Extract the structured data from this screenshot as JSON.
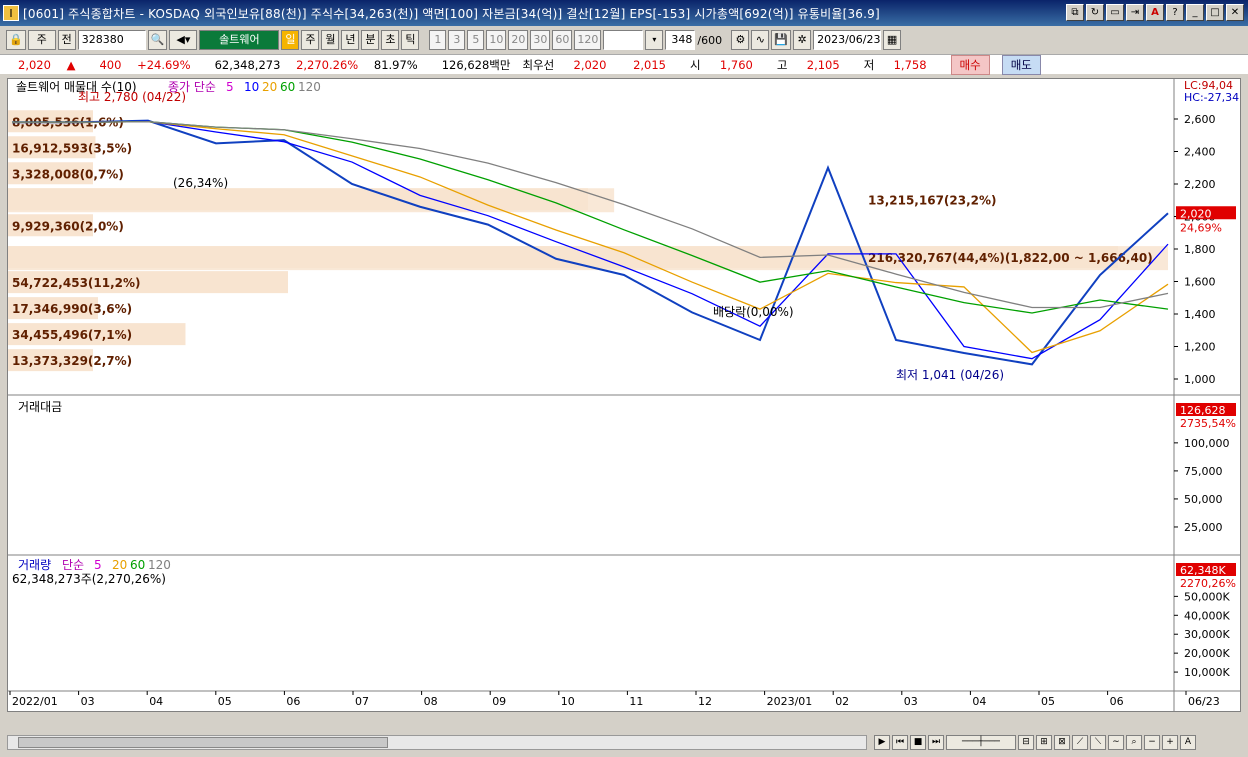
{
  "window": {
    "title": "[0601] 주식종합차트 - KOSDAQ 외국인보유[88(천)] 주식수[34,263(천)] 액면[100] 자본금[34(억)] 결산[12월] EPS[-153] 시가총액[692(억)] 유통비율[36.9]",
    "title_buttons": [
      "□",
      "⊡",
      "▭",
      "⇥",
      "A",
      "?",
      "_",
      "□",
      "X"
    ]
  },
  "toolbar": {
    "type_select": "주",
    "prev_label": "전",
    "code": "328380",
    "stock_name": "솔트웨어",
    "period_tabs": [
      "일",
      "주",
      "월",
      "년",
      "분",
      "초",
      "틱"
    ],
    "intervals": [
      "1",
      "3",
      "5",
      "10",
      "20",
      "30",
      "60",
      "120"
    ],
    "count": "348",
    "count_total": "/600",
    "date": "2023/06/23"
  },
  "quote": {
    "price": "2,020",
    "price_arrow": "▲",
    "change": "400",
    "change_pct": "+24.69%",
    "volume": "62,348,273",
    "volume_pct": "2,270.26%",
    "turnover_pct": "81.97%",
    "amount": "126,628백만",
    "best_bid_label": "최우선",
    "best_ask": "2,020",
    "best_bid": "2,015",
    "open_label": "시",
    "open": "1,760",
    "high_label": "고",
    "high": "2,105",
    "low_label": "저",
    "low": "1,758",
    "buy_label": "매수",
    "sell_label": "매도"
  },
  "chart_data": [
    {
      "type": "line",
      "panel": "price",
      "title": "솔트웨어 매물대 수(10)",
      "ma_legend": {
        "label": "종가 단순",
        "periods": [
          "5",
          "10",
          "20",
          "60",
          "120"
        ],
        "colors": [
          "#d000d0",
          "#0000ff",
          "#e8a000",
          "#00a000",
          "#808080"
        ]
      },
      "x": [
        "2022/01",
        "03",
        "04",
        "05",
        "06",
        "07",
        "08",
        "09",
        "10",
        "11",
        "12",
        "2023/01",
        "02",
        "03",
        "04",
        "05",
        "06",
        "06/23"
      ],
      "close_approx": [
        2580,
        2580,
        2590,
        2450,
        2470,
        2200,
        2060,
        1950,
        1740,
        1640,
        1410,
        1240,
        2300,
        1240,
        1160,
        1090,
        1640,
        2020
      ],
      "ylim": [
        950,
        2700
      ],
      "yticks": [
        "2,600",
        "2,400",
        "2,200",
        "2,000",
        "1,800",
        "1,600",
        "1,400",
        "1,200",
        "1,000"
      ],
      "right_labels": [
        "LC:94,04",
        "HC:-27,34"
      ],
      "last_price_tag": "2,020",
      "last_pct_tag": "24,69%",
      "volume_profile": [
        {
          "label": "8,005,536(1,6%)",
          "price": 2580,
          "share": 1.6
        },
        {
          "label": "16,912,593(3,5%)",
          "price": 2420,
          "share": 3.5
        },
        {
          "label": "3,328,008(0,7%)",
          "price": 2260,
          "share": 0.7
        },
        {
          "label": "13,215,167(23,2%)",
          "price": 2100,
          "share": 23.2
        },
        {
          "label": "9,929,360(2,0%)",
          "price": 1940,
          "share": 2.0
        },
        {
          "label": "216,320,767(44,4%)(1,822,00 ~ 1,666,40)",
          "price": 1744,
          "share": 44.4
        },
        {
          "label": "54,722,453(11,2%)",
          "price": 1590,
          "share": 11.2
        },
        {
          "label": "17,346,990(3,6%)",
          "price": 1430,
          "share": 3.6
        },
        {
          "label": "34,455,496(7,1%)",
          "price": 1270,
          "share": 7.1
        },
        {
          "label": "13,373,329(2,7%)",
          "price": 1110,
          "share": 2.7
        }
      ],
      "annotations": [
        "최고 2,780 (04/22)",
        "(26,34%)",
        "배당락(0,00%)",
        "최저 1,041 (04/26)"
      ]
    },
    {
      "type": "bar",
      "panel": "amount",
      "title": "거래대금",
      "ylim": [
        0,
        126628
      ],
      "yticks": [
        "100,000",
        "75,000",
        "50,000",
        "25,000"
      ],
      "last_tag": "126,628",
      "last_pct_tag": "2735,54%"
    },
    {
      "type": "bar",
      "panel": "volume",
      "title": "거래량",
      "ma_legend": {
        "label": "단순",
        "periods": [
          "5",
          "20",
          "60",
          "120"
        ],
        "colors": [
          "#d000d0",
          "#e8a000",
          "#00a000",
          "#808080"
        ]
      },
      "subtitle": "62,348,273주(2,270,26%)",
      "ylim": [
        0,
        62348
      ],
      "yticks": [
        "50,000K",
        "40,000K",
        "30,000K",
        "20,000K",
        "10,000K"
      ],
      "last_tag": "62,348K",
      "last_pct_tag": "2270,26%"
    }
  ],
  "status": {
    "right_icons": [
      "play",
      "first",
      "stop",
      "last",
      "zoom-out",
      "zoom-minus",
      "zoom-plus",
      "font-A"
    ]
  }
}
